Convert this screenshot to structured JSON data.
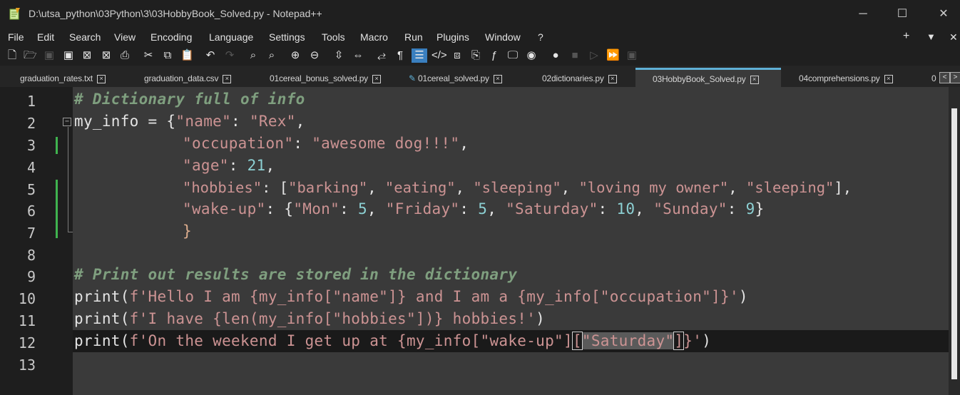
{
  "window": {
    "title": "D:\\utsa_python\\03Python\\3\\03HobbyBook_Solved.py - Notepad++",
    "minimize": "─",
    "maximize": "☐",
    "close": "✕"
  },
  "menu": {
    "items": [
      "File",
      "Edit",
      "Search",
      "View",
      "Encoding",
      "Language",
      "Settings",
      "Tools",
      "Macro",
      "Run",
      "Plugins",
      "Window",
      "?"
    ],
    "right_plus": "+",
    "right_down": "▼",
    "right_close": "✕"
  },
  "tabs": [
    {
      "label": "graduation_rates.txt",
      "active": false
    },
    {
      "label": "graduation_data.csv",
      "active": false
    },
    {
      "label": "01cereal_bonus_solved.py",
      "active": false
    },
    {
      "label": "01cereal_solved.py",
      "active": false
    },
    {
      "label": "02dictionaries.py",
      "active": false
    },
    {
      "label": "03HobbyBook_Solved.py",
      "active": true
    },
    {
      "label": "04comprehensions.py",
      "active": false
    },
    {
      "label": "0",
      "active": false
    }
  ],
  "tab_nav": {
    "left": "<",
    "right": ">"
  },
  "editor": {
    "line_numbers": [
      "1",
      "2",
      "3",
      "4",
      "5",
      "6",
      "7",
      "8",
      "9",
      "10",
      "11",
      "12",
      "13"
    ],
    "current_line": 12,
    "colors": {
      "comment": "#7f9f7f",
      "string": "#cc9393",
      "number": "#8cd0d3",
      "background": "#3a3a3a"
    },
    "code": {
      "l1": "# Dictionary full of info",
      "l2a": "my_info = {",
      "l2b": "\"name\"",
      "l2c": ": ",
      "l2d": "\"Rex\"",
      "l2e": ",",
      "l3a": "\"occupation\"",
      "l3b": ": ",
      "l3c": "\"awesome dog!!!\"",
      "l3d": ",",
      "l4a": "\"age\"",
      "l4b": ": ",
      "l4c": "21",
      "l4d": ",",
      "l5a": "\"hobbies\"",
      "l5b": ": [",
      "l5c": "\"barking\"",
      "l5d": ", ",
      "l5e": "\"eating\"",
      "l5f": ", ",
      "l5g": "\"sleeping\"",
      "l5h": ", ",
      "l5i": "\"loving my owner\"",
      "l5j": ", ",
      "l5k": "\"sleeping\"",
      "l5l": "],",
      "l6a": "\"wake-up\"",
      "l6b": ": {",
      "l6c": "\"Mon\"",
      "l6d": ": ",
      "l6e": "5",
      "l6f": ", ",
      "l6g": "\"Friday\"",
      "l6h": ": ",
      "l6i": "5",
      "l6j": ", ",
      "l6k": "\"Saturday\"",
      "l6l": ": ",
      "l6m": "10",
      "l6n": ", ",
      "l6o": "\"Sunday\"",
      "l6p": ": ",
      "l6q": "9",
      "l6r": "}",
      "l7": "}",
      "l9": "# Print out results are stored in the dictionary",
      "l10a": "print(",
      "l10b": "f'Hello I am {my_info[\"name\"]} and I am a {my_info[\"occupation\"]}'",
      "l10c": ")",
      "l11a": "print(",
      "l11b": "f'I have {len(my_info[\"hobbies\"])} hobbies!'",
      "l11c": ")",
      "l12a": "print(",
      "l12b": "f'On the weekend I get up at {my_info[\"wake-up\"]",
      "l12c": "[",
      "l12d": "\"Saturday\"",
      "l12e": "]",
      "l12f": "}'",
      "l12g": ")"
    }
  }
}
